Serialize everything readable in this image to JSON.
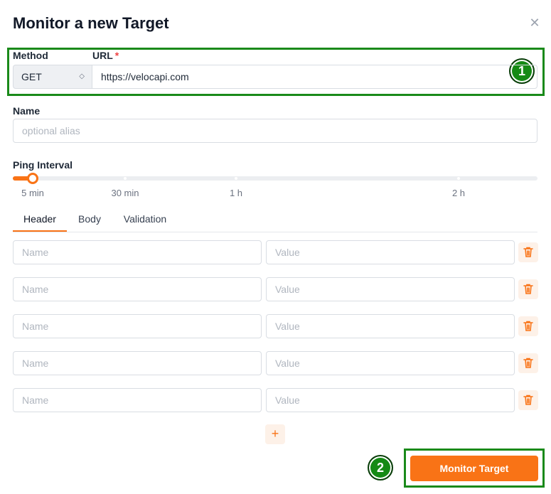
{
  "dialog": {
    "title": "Monitor a new Target",
    "close_icon": "close-icon"
  },
  "form": {
    "method_label": "Method",
    "url_label": "URL",
    "url_required_mark": "*",
    "method_value": "GET",
    "url_value": "https://velocapi.com",
    "name_label": "Name",
    "name_placeholder": "optional alias",
    "ping_label": "Ping Interval",
    "ping_selected": "5 min",
    "ping_ticks": [
      "5 min",
      "30 min",
      "1 h",
      "2 h"
    ]
  },
  "tabs": [
    {
      "label": "Header",
      "active": true
    },
    {
      "label": "Body",
      "active": false
    },
    {
      "label": "Validation",
      "active": false
    }
  ],
  "headers": {
    "name_placeholder": "Name",
    "value_placeholder": "Value",
    "rows": 5
  },
  "submit_label": "Monitor Target",
  "annotations": {
    "badge_1": "1",
    "badge_2": "2"
  },
  "colors": {
    "accent": "#f97316",
    "highlight": "#1a8a1a"
  }
}
